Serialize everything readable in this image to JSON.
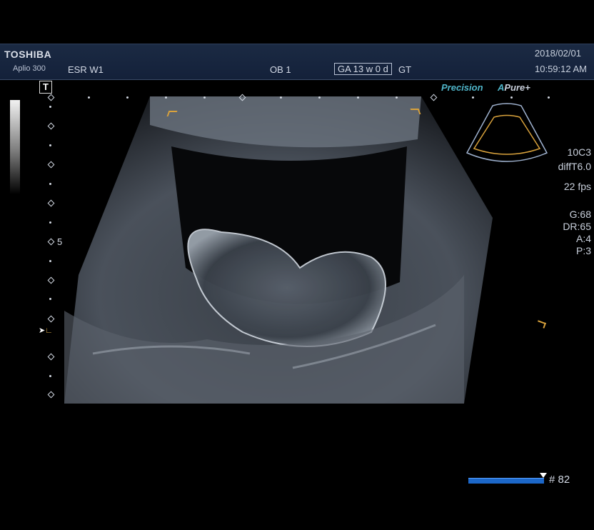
{
  "header": {
    "brand": "TOSHIBA",
    "model": "Aplio 300",
    "preset": "ESR W1",
    "exam_mode": "OB 1",
    "gestational_age": "GA  13 w 0 d",
    "gt_label": "GT",
    "date": "2018/02/01",
    "time": "10:59:12 AM"
  },
  "overlay": {
    "t_marker": "T",
    "depth_mark": "5",
    "precision_label": "Precision",
    "apure_a": "A",
    "apure_label": "Pure+"
  },
  "params": {
    "probe": "10C3",
    "freq": "diffT6.0",
    "fps": "22 fps",
    "gain": "G:68",
    "dr": "DR:65",
    "a": "A:4",
    "p": "P:3"
  },
  "cine": {
    "frame_label": "# 82"
  },
  "colors": {
    "header_bg": "#1b2a43",
    "accent_cyan": "#4fb5c9",
    "marker_orange": "#d9a23c",
    "cine_blue": "#1c67c8"
  }
}
